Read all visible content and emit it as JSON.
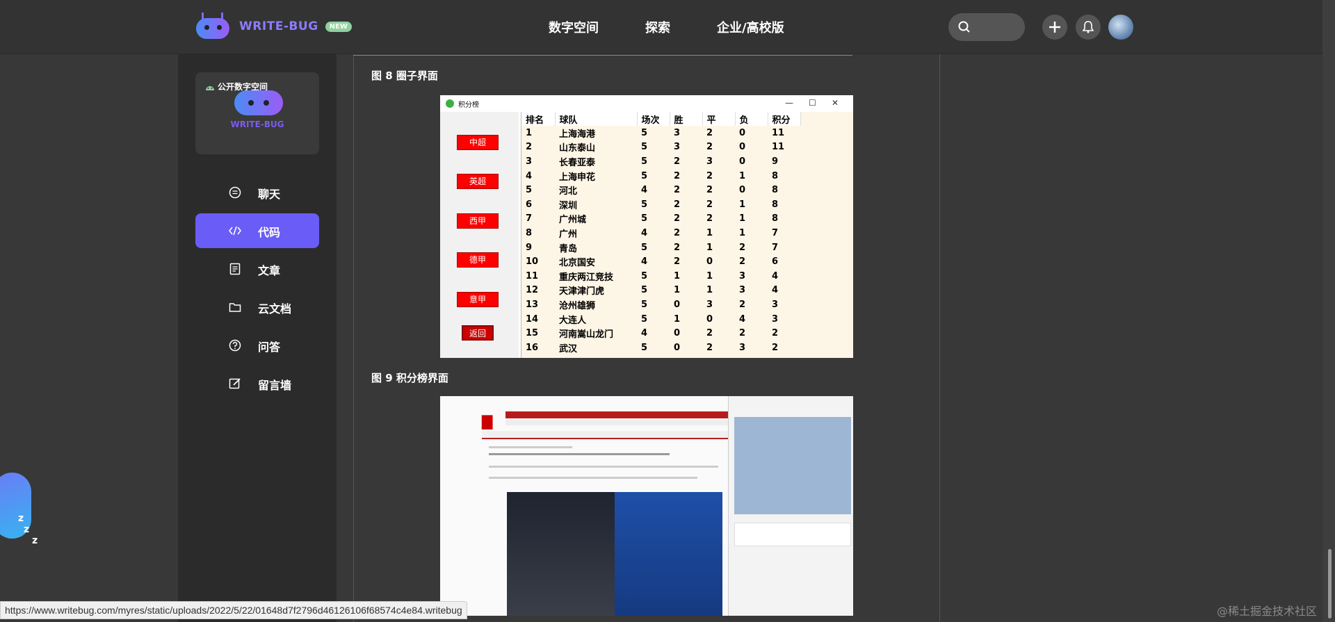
{
  "header": {
    "logo_text": "WRITE-BUG",
    "logo_badge": "NEW",
    "nav": [
      "数字空间",
      "探索",
      "企业/高校版"
    ]
  },
  "sidebar": {
    "card": {
      "badge": "公开数字空间",
      "name": "WRITE-BUG"
    },
    "items": [
      {
        "label": "聊天",
        "icon": "chat-icon",
        "active": false
      },
      {
        "label": "代码",
        "icon": "code-icon",
        "active": true
      },
      {
        "label": "文章",
        "icon": "article-icon",
        "active": false
      },
      {
        "label": "云文档",
        "icon": "folder-icon",
        "active": false
      },
      {
        "label": "问答",
        "icon": "question-icon",
        "active": false
      },
      {
        "label": "留言墙",
        "icon": "edit-icon",
        "active": false
      }
    ]
  },
  "main": {
    "fig8_caption": "图 8 圈子界面",
    "fig9_caption": "图 9 积分榜界面",
    "standings_window": {
      "title": "积分榜",
      "leagues": [
        "中超",
        "英超",
        "西甲",
        "德甲",
        "意甲"
      ],
      "back_label": "返回",
      "columns": [
        "排名",
        "球队",
        "场次",
        "胜",
        "平",
        "负",
        "积分"
      ],
      "rows": [
        [
          "1",
          "上海海港",
          "5",
          "3",
          "2",
          "0",
          "11"
        ],
        [
          "2",
          "山东泰山",
          "5",
          "3",
          "2",
          "0",
          "11"
        ],
        [
          "3",
          "长春亚泰",
          "5",
          "2",
          "3",
          "0",
          "9"
        ],
        [
          "4",
          "上海申花",
          "5",
          "2",
          "2",
          "1",
          "8"
        ],
        [
          "5",
          "河北",
          "4",
          "2",
          "2",
          "0",
          "8"
        ],
        [
          "6",
          "深圳",
          "5",
          "2",
          "2",
          "1",
          "8"
        ],
        [
          "7",
          "广州城",
          "5",
          "2",
          "2",
          "1",
          "8"
        ],
        [
          "8",
          "广州",
          "4",
          "2",
          "1",
          "1",
          "7"
        ],
        [
          "9",
          "青岛",
          "5",
          "2",
          "1",
          "2",
          "7"
        ],
        [
          "10",
          "北京国安",
          "4",
          "2",
          "0",
          "2",
          "6"
        ],
        [
          "11",
          "重庆两江竞技",
          "5",
          "1",
          "1",
          "3",
          "4"
        ],
        [
          "12",
          "天津津门虎",
          "5",
          "1",
          "1",
          "3",
          "4"
        ],
        [
          "13",
          "沧州雄狮",
          "5",
          "0",
          "3",
          "2",
          "3"
        ],
        [
          "14",
          "大连人",
          "5",
          "1",
          "0",
          "4",
          "3"
        ],
        [
          "15",
          "河南嵩山龙门",
          "4",
          "0",
          "2",
          "2",
          "2"
        ],
        [
          "16",
          "武汉",
          "5",
          "0",
          "2",
          "3",
          "2"
        ]
      ]
    }
  },
  "status_url": "https://www.writebug.com/myres/static/uploads/2022/5/22/01648d7f2796d46126106f68574c4e84.writebug",
  "watermark": "@稀土掘金技术社区",
  "colors": {
    "accent": "#6a5cf6",
    "league_button": "#ff0000",
    "table_bg": "#fdf5e6"
  }
}
